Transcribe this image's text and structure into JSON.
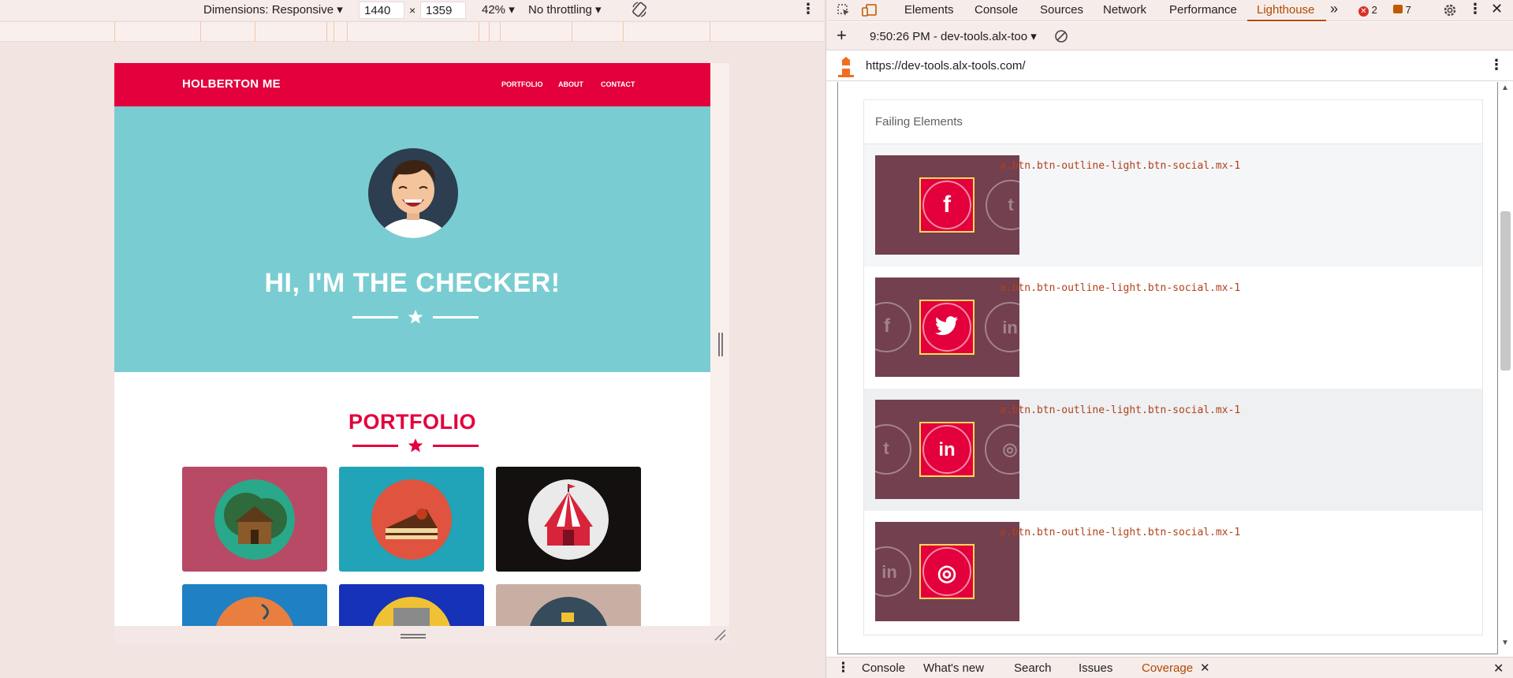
{
  "device_toolbar": {
    "dimensions_label": "Dimensions: Responsive",
    "width": "1440",
    "times": "×",
    "height": "1359",
    "zoom": "42%",
    "throttling": "No throttling"
  },
  "site": {
    "brand": "HOLBERTON ME",
    "nav": [
      "PORTFOLIO",
      "ABOUT",
      "CONTACT"
    ],
    "hero_title": "HI, I'M THE CHECKER!",
    "portfolio_title": "PORTFOLIO",
    "tile_colors": [
      "#b94a66",
      "#21a3b8",
      "#141010",
      "#2080c4",
      "#1532b8",
      "#c9afa3"
    ]
  },
  "devtools": {
    "tabs": [
      "Elements",
      "Console",
      "Sources",
      "Network",
      "Performance",
      "Lighthouse"
    ],
    "active_tab": "Lighthouse",
    "error_count": "2",
    "message_count": "7",
    "report_select": "9:50:26 PM - dev-tools.alx-too",
    "report_url": "https://dev-tools.alx-tools.com/",
    "failing_header": "Failing Elements",
    "failing_rows": [
      {
        "selector": "a.btn.btn-outline-light.btn-social.mx-1",
        "icon": "facebook-icon",
        "glyph": "f"
      },
      {
        "selector": "a.btn.btn-outline-light.btn-social.mx-1",
        "icon": "twitter-icon",
        "glyph": "🐦"
      },
      {
        "selector": "a.btn.btn-outline-light.btn-social.mx-1",
        "icon": "linkedin-icon",
        "glyph": "in"
      },
      {
        "selector": "a.btn.btn-outline-light.btn-social.mx-1",
        "icon": "dribbble-icon",
        "glyph": "◎"
      }
    ],
    "drawer_tabs": [
      "Console",
      "What's new",
      "Search",
      "Issues",
      "Coverage"
    ],
    "active_drawer_tab": "Coverage"
  }
}
